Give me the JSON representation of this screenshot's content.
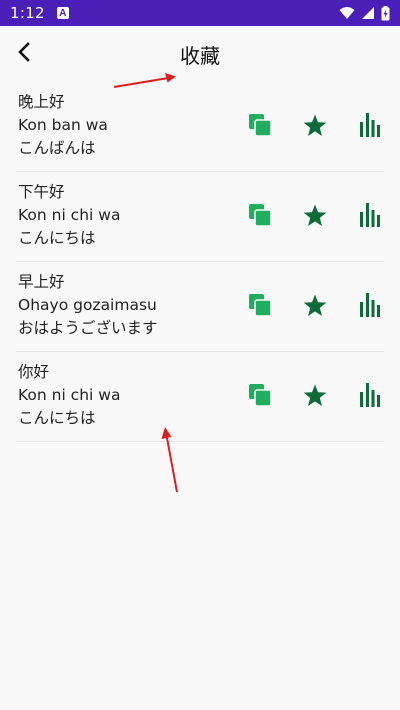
{
  "status_bar": {
    "time": "1:12",
    "app_indicator": "A",
    "icons": [
      "wifi-icon",
      "signal-icon",
      "battery-charging-icon"
    ],
    "color": "#4a1fb8"
  },
  "header": {
    "back_icon": "chevron-left-icon",
    "title": "收藏"
  },
  "favorites": [
    {
      "chinese": "晚上好",
      "romaji": "Kon ban wa",
      "japanese": "こんばんは"
    },
    {
      "chinese": "下午好",
      "romaji": "Kon ni chi wa",
      "japanese": "こんにちは"
    },
    {
      "chinese": "早上好",
      "romaji": "Ohayo gozaimasu",
      "japanese": "おはようございます"
    },
    {
      "chinese": "你好",
      "romaji": "Kon ni chi wa",
      "japanese": "こんにちは"
    }
  ],
  "actions": {
    "icons": [
      "copy-icon",
      "star-icon",
      "audio-bars-icon"
    ]
  },
  "colors": {
    "copy": "#1fad5e",
    "star": "#0d6b3a",
    "bars": "#0d6b3a",
    "annotation": "#e31b1b"
  }
}
